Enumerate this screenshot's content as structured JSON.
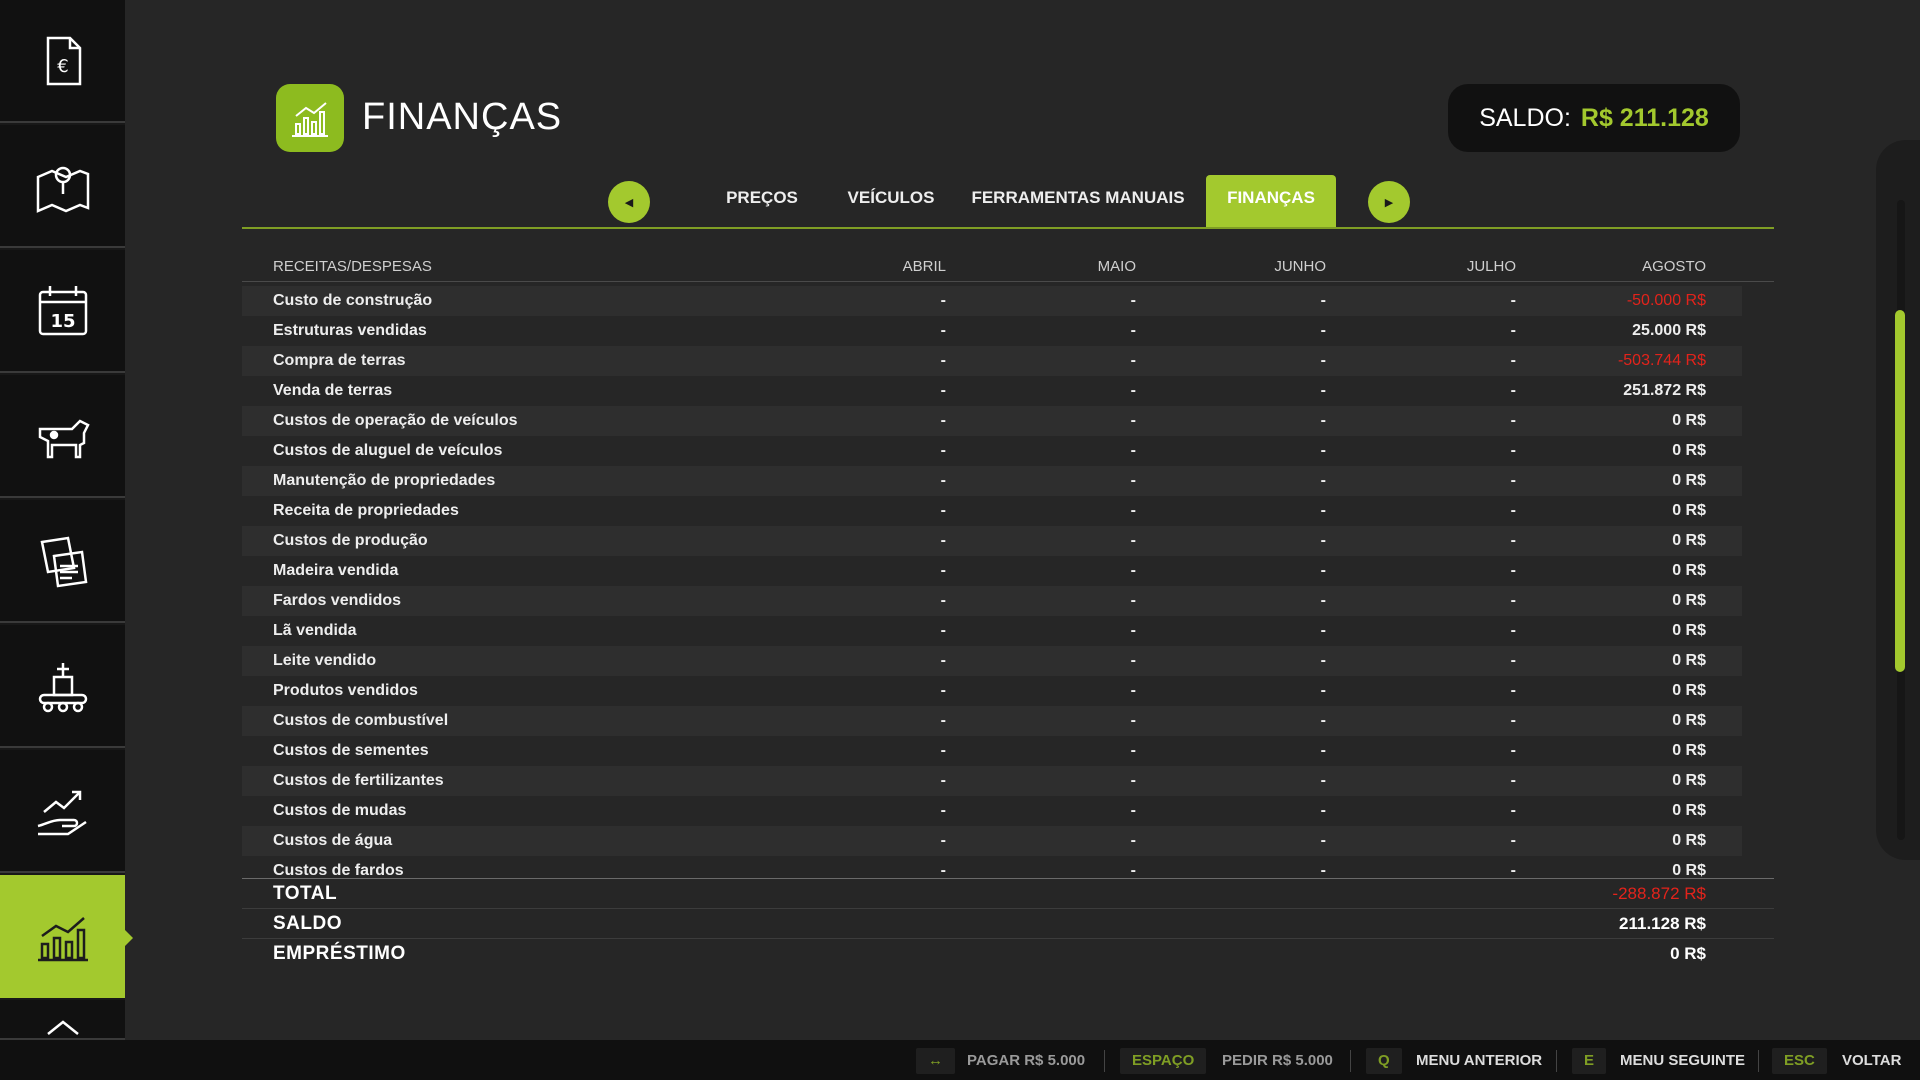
{
  "header": {
    "title": "FINANÇAS",
    "balance_label": "SALDO:",
    "balance_value": "R$ 211.128"
  },
  "sidebar": {
    "items": [
      {
        "name": "invoice-euro-icon"
      },
      {
        "name": "map-pin-icon"
      },
      {
        "name": "calendar-icon",
        "text": "15"
      },
      {
        "name": "cow-icon"
      },
      {
        "name": "contracts-icon"
      },
      {
        "name": "production-icon"
      },
      {
        "name": "price-trend-icon"
      },
      {
        "name": "finance-chart-icon",
        "active": true
      },
      {
        "name": "chevron-up-icon"
      }
    ]
  },
  "tabs": [
    {
      "label": "PREÇOS"
    },
    {
      "label": "VEÍCULOS"
    },
    {
      "label": "FERRAMENTAS MANUAIS"
    },
    {
      "label": "FINANÇAS",
      "active": true
    }
  ],
  "table": {
    "headers": [
      "RECEITAS/DESPESAS",
      "ABRIL",
      "MAIO",
      "JUNHO",
      "JULHO",
      "AGOSTO"
    ],
    "rows": [
      {
        "label": "Custo de construção",
        "m": [
          "-",
          "-",
          "-",
          "-"
        ],
        "value": "-50.000 R$",
        "negative": true
      },
      {
        "label": "Estruturas vendidas",
        "m": [
          "-",
          "-",
          "-",
          "-"
        ],
        "value": "25.000 R$"
      },
      {
        "label": "Compra de terras",
        "m": [
          "-",
          "-",
          "-",
          "-"
        ],
        "value": "-503.744 R$",
        "negative": true
      },
      {
        "label": "Venda de terras",
        "m": [
          "-",
          "-",
          "-",
          "-"
        ],
        "value": "251.872 R$"
      },
      {
        "label": "Custos de operação de veículos",
        "m": [
          "-",
          "-",
          "-",
          "-"
        ],
        "value": "0 R$"
      },
      {
        "label": "Custos de aluguel de veículos",
        "m": [
          "-",
          "-",
          "-",
          "-"
        ],
        "value": "0 R$"
      },
      {
        "label": "Manutenção de propriedades",
        "m": [
          "-",
          "-",
          "-",
          "-"
        ],
        "value": "0 R$"
      },
      {
        "label": "Receita de propriedades",
        "m": [
          "-",
          "-",
          "-",
          "-"
        ],
        "value": "0 R$"
      },
      {
        "label": "Custos de produção",
        "m": [
          "-",
          "-",
          "-",
          "-"
        ],
        "value": "0 R$"
      },
      {
        "label": "Madeira vendida",
        "m": [
          "-",
          "-",
          "-",
          "-"
        ],
        "value": "0 R$"
      },
      {
        "label": "Fardos vendidos",
        "m": [
          "-",
          "-",
          "-",
          "-"
        ],
        "value": "0 R$"
      },
      {
        "label": "Lã vendida",
        "m": [
          "-",
          "-",
          "-",
          "-"
        ],
        "value": "0 R$"
      },
      {
        "label": "Leite vendido",
        "m": [
          "-",
          "-",
          "-",
          "-"
        ],
        "value": "0 R$"
      },
      {
        "label": "Produtos vendidos",
        "m": [
          "-",
          "-",
          "-",
          "-"
        ],
        "value": "0 R$"
      },
      {
        "label": "Custos de combustível",
        "m": [
          "-",
          "-",
          "-",
          "-"
        ],
        "value": "0 R$"
      },
      {
        "label": "Custos de sementes",
        "m": [
          "-",
          "-",
          "-",
          "-"
        ],
        "value": "0 R$"
      },
      {
        "label": "Custos de fertilizantes",
        "m": [
          "-",
          "-",
          "-",
          "-"
        ],
        "value": "0 R$"
      },
      {
        "label": "Custos de mudas",
        "m": [
          "-",
          "-",
          "-",
          "-"
        ],
        "value": "0 R$"
      },
      {
        "label": "Custos de água",
        "m": [
          "-",
          "-",
          "-",
          "-"
        ],
        "value": "0 R$"
      },
      {
        "label": "Custos de fardos",
        "m": [
          "-",
          "-",
          "-",
          "-"
        ],
        "value": "0 R$"
      }
    ]
  },
  "totals": [
    {
      "label": "TOTAL",
      "value": "-288.872 R$",
      "negative": true
    },
    {
      "label": "SALDO",
      "value": "211.128 R$"
    },
    {
      "label": "EMPRÉSTIMO",
      "value": "0 R$"
    }
  ],
  "footer": {
    "pay_key": "↔",
    "pay_label": "PAGAR R$ 5.000",
    "borrow_key": "ESPAÇO",
    "borrow_label": "PEDIR R$ 5.000",
    "prev_key": "Q",
    "prev_label": "MENU ANTERIOR",
    "next_key": "E",
    "next_label": "MENU SEGUINTE",
    "back_key": "ESC",
    "back_label": "VOLTAR"
  },
  "colors": {
    "accent": "#a3c92e",
    "negative": "#e3231b",
    "background": "#262626"
  }
}
